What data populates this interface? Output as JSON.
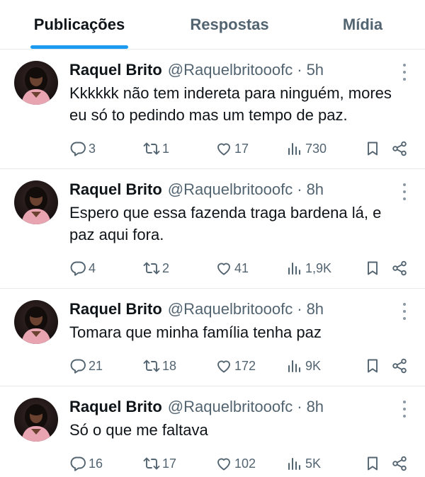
{
  "tabs": [
    {
      "label": "Publicações",
      "active": true
    },
    {
      "label": "Respostas",
      "active": false
    },
    {
      "label": "Mídia",
      "active": false
    }
  ],
  "colors": {
    "accent": "#1d9bf0",
    "text": "#0f1419",
    "muted": "#536471"
  },
  "posts": [
    {
      "name": "Raquel Brito",
      "handle": "@Raquelbritooofc",
      "sep": "·",
      "time": "5h",
      "text": "Kkkkkk não tem indereta para ninguém, mores eu só to pedindo mas um tempo de paz.",
      "replies": "3",
      "reposts": "1",
      "likes": "17",
      "views": "730"
    },
    {
      "name": "Raquel Brito",
      "handle": "@Raquelbritooofc",
      "sep": "·",
      "time": "8h",
      "text": "Espero que essa fazenda traga bardena lá, e paz aqui fora.",
      "replies": "4",
      "reposts": "2",
      "likes": "41",
      "views": "1,9K"
    },
    {
      "name": "Raquel Brito",
      "handle": "@Raquelbritooofc",
      "sep": "·",
      "time": "8h",
      "text": "Tomara que minha família tenha paz",
      "replies": "21",
      "reposts": "18",
      "likes": "172",
      "views": "9K"
    },
    {
      "name": "Raquel Brito",
      "handle": "@Raquelbritooofc",
      "sep": "·",
      "time": "8h",
      "text": "Só o que me faltava",
      "replies": "16",
      "reposts": "17",
      "likes": "102",
      "views": "5K"
    }
  ]
}
